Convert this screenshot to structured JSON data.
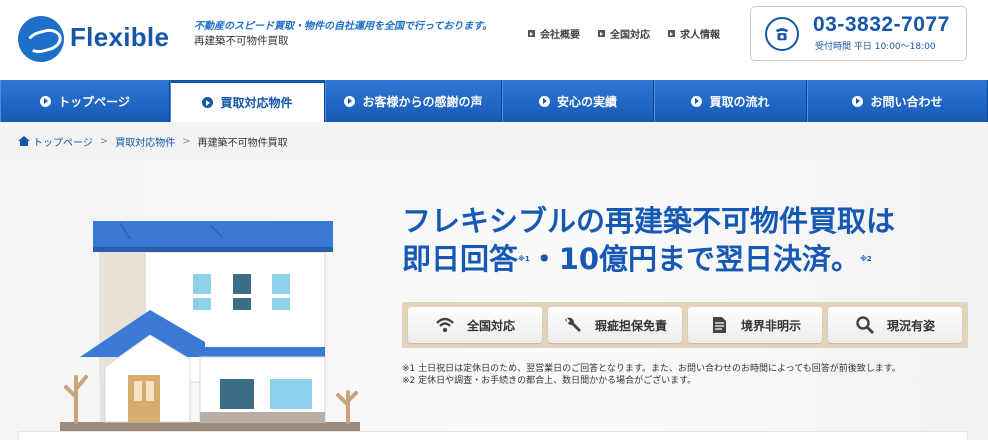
{
  "header": {
    "logo_text": "Flexible",
    "tagline": "不動産のスピード買取・物件の自社運用を全国で行っております。",
    "subtitle": "再建築不可物件買取",
    "top_links": [
      "会社概要",
      "全国対応",
      "求人情報"
    ],
    "phone_number": "03-3832-7077",
    "phone_hours": "受付時間 平日 10:00～18:00"
  },
  "nav": {
    "items": [
      {
        "label": "トップページ"
      },
      {
        "label": "買取対応物件"
      },
      {
        "label": "お客様からの感謝の声"
      },
      {
        "label": "安心の実績"
      },
      {
        "label": "買取の流れ"
      },
      {
        "label": "お問い合わせ"
      }
    ],
    "active_index": 1
  },
  "breadcrumb": {
    "items": [
      "トップページ",
      "買取対応物件",
      "再建築不可物件買取"
    ],
    "separator": ">"
  },
  "hero": {
    "title_line1": "フレキシブルの再建築不可物件買取は",
    "title_line2_a": "即日回答",
    "title_line2_sup1": "※1",
    "title_line2_b": "・10億円まで翌日決済。",
    "title_line2_sup2": "※2",
    "features": [
      {
        "label": "全国対応",
        "icon": "wifi-icon"
      },
      {
        "label": "瑕疵担保免責",
        "icon": "wrench-icon"
      },
      {
        "label": "境界非明示",
        "icon": "document-icon"
      },
      {
        "label": "現況有姿",
        "icon": "magnifier-icon"
      }
    ],
    "note1": "※1 土日祝日は定休日のため、翌営業日のご回答となります。また、お問い合わせのお時間によっても回答が前後致します。",
    "note2": "※2 定休日や調査・お手続きの都合上、数日間かかる場合がございます。"
  },
  "colors": {
    "brand_blue": "#1659b5",
    "nav_top": "#2f78d3",
    "feature_bar": "#e3d3bd"
  }
}
